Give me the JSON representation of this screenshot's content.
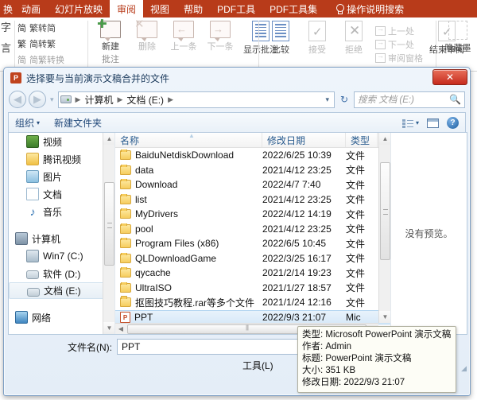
{
  "ribbon": {
    "left_cut_tabs": "换",
    "tabs": [
      {
        "label": "动画",
        "active": false
      },
      {
        "label": "幻灯片放映",
        "active": false
      },
      {
        "label": "审阅",
        "active": true
      },
      {
        "label": "视图",
        "active": false
      },
      {
        "label": "帮助",
        "active": false
      },
      {
        "label": "PDF工具",
        "active": false
      },
      {
        "label": "PDF工具集",
        "active": false
      }
    ],
    "tell_me": "操作说明搜索",
    "left_column": [
      "字",
      "言"
    ],
    "convert_group": [
      {
        "glyph": "简",
        "label": "繁转简"
      },
      {
        "glyph": "繁",
        "label": "简转繁"
      },
      {
        "glyph": "简",
        "label": "简繁转换"
      }
    ],
    "comment_group": [
      {
        "label": "新建",
        "label2": "批注",
        "dim": false,
        "icon": "new-comment-icon"
      },
      {
        "label": "删除",
        "label2": "",
        "dim": true,
        "icon": "delete-comment-icon"
      },
      {
        "label": "上一条",
        "label2": "",
        "dim": true,
        "icon": "previous-comment-icon"
      },
      {
        "label": "下一条",
        "label2": "",
        "dim": true,
        "icon": "next-comment-icon"
      },
      {
        "label": "显示批注",
        "label2": "",
        "dim": false,
        "icon": "show-comments-icon"
      }
    ],
    "compare_group": [
      {
        "label": "比较",
        "dim": false,
        "icon": "compare-icon"
      },
      {
        "label": "接受",
        "dim": true,
        "icon": "accept-icon"
      },
      {
        "label": "拒绝",
        "dim": true,
        "icon": "reject-icon"
      }
    ],
    "nav_items": [
      "上一处",
      "下一处",
      "审阅窗格"
    ],
    "end_review": "结束审阅",
    "hide_ink": "隐藏墨"
  },
  "dialog": {
    "title": "选择要与当前演示文稿合并的文件",
    "app_icon_letter": "P",
    "close_label": "✕",
    "breadcrumb": [
      "计算机",
      "文档 (E:)"
    ],
    "search_placeholder": "搜索 文档 (E:)",
    "toolbar": {
      "organize": "组织",
      "new_folder": "新建文件夹",
      "help": "?"
    },
    "sidebar": {
      "items": [
        {
          "label": "视频",
          "icon": "video-icon",
          "indent": true,
          "selected": false
        },
        {
          "label": "腾讯视频",
          "icon": "folder-icon",
          "indent": true,
          "selected": false
        },
        {
          "label": "图片",
          "icon": "pictures-icon",
          "indent": true,
          "selected": false
        },
        {
          "label": "文档",
          "icon": "documents-icon",
          "indent": true,
          "selected": false
        },
        {
          "label": "音乐",
          "icon": "music-icon",
          "indent": true,
          "selected": false
        }
      ],
      "computer_group": {
        "label": "计算机",
        "icon": "computer-icon",
        "drives": [
          {
            "label": "Win7 (C:)",
            "icon": "system-drive-icon",
            "selected": false
          },
          {
            "label": "软件 (D:)",
            "icon": "drive-icon",
            "selected": false
          },
          {
            "label": "文档 (E:)",
            "icon": "drive-icon",
            "selected": true
          }
        ]
      },
      "network": {
        "label": "网络",
        "icon": "network-icon"
      }
    },
    "columns": [
      {
        "key": "name",
        "label": "名称"
      },
      {
        "key": "date",
        "label": "修改日期"
      },
      {
        "key": "type",
        "label": "类型"
      }
    ],
    "files": [
      {
        "name": "BaiduNetdiskDownload",
        "date": "2022/6/25 10:39",
        "type": "文件",
        "icon": "folder-icon",
        "selected": false
      },
      {
        "name": "data",
        "date": "2021/4/12 23:25",
        "type": "文件",
        "icon": "folder-icon",
        "selected": false
      },
      {
        "name": "Download",
        "date": "2022/4/7 7:40",
        "type": "文件",
        "icon": "folder-icon",
        "selected": false
      },
      {
        "name": "list",
        "date": "2021/4/12 23:25",
        "type": "文件",
        "icon": "folder-icon",
        "selected": false
      },
      {
        "name": "MyDrivers",
        "date": "2022/4/12 14:19",
        "type": "文件",
        "icon": "folder-icon",
        "selected": false
      },
      {
        "name": "pool",
        "date": "2021/4/12 23:25",
        "type": "文件",
        "icon": "folder-icon",
        "selected": false
      },
      {
        "name": "Program Files (x86)",
        "date": "2022/6/5 10:45",
        "type": "文件",
        "icon": "folder-icon",
        "selected": false
      },
      {
        "name": "QLDownloadGame",
        "date": "2022/3/25 16:17",
        "type": "文件",
        "icon": "folder-icon",
        "selected": false
      },
      {
        "name": "qycache",
        "date": "2021/2/14 19:23",
        "type": "文件",
        "icon": "folder-icon",
        "selected": false
      },
      {
        "name": "UltraISO",
        "date": "2021/1/27 18:57",
        "type": "文件",
        "icon": "folder-icon",
        "selected": false
      },
      {
        "name": "抠图技巧教程.rar等多个文件",
        "date": "2021/1/24 12:16",
        "type": "文件",
        "icon": "folder-icon",
        "selected": false
      },
      {
        "name": "PPT",
        "date": "2022/9/3 21:07",
        "type": "Mic",
        "icon": "powerpoint-file-icon",
        "selected": true
      }
    ],
    "preview_text": "没有预览。",
    "filename_label": "文件名(N):",
    "filename_value": "PPT",
    "tools_label": "工具(L)"
  },
  "tooltip": {
    "lines": [
      "类型: Microsoft PowerPoint 演示文稿",
      "作者: Admin",
      "标题: PowerPoint 演示文稿",
      "大小: 351 KB",
      "修改日期: 2022/9/3 21:07"
    ]
  }
}
